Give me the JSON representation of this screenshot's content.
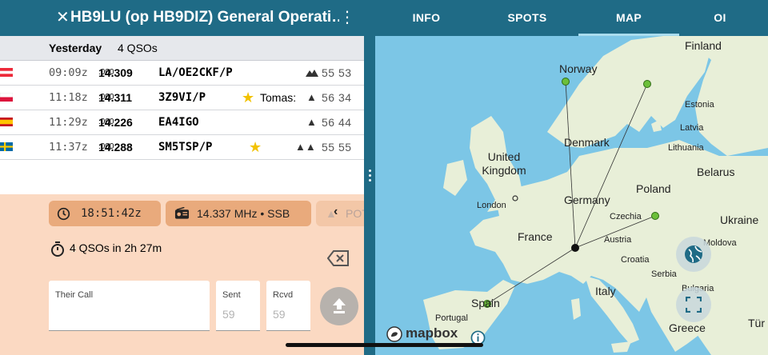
{
  "header": {
    "close_icon": "close-icon",
    "title": "HB9LU (op HB9DIZ) General Operati…",
    "menu_icon": "more-vertical-icon",
    "tabs": [
      {
        "label": "INFO"
      },
      {
        "label": "SPOTS"
      },
      {
        "label": "MAP",
        "active": true
      },
      {
        "label": "OI"
      }
    ]
  },
  "log": {
    "day": "Yesterday",
    "count": "4 QSOs",
    "rows": [
      {
        "time": "09:09z",
        "freq_main": "14.309",
        "freq_small": ".000",
        "call": "LA/OE2CKF/P",
        "flag": "AT",
        "star": "",
        "note": "",
        "icon": "mountain-icon",
        "rst": "55 53"
      },
      {
        "time": "11:18z",
        "freq_main": "14.311",
        "freq_small": ".000",
        "call": "3Z9VI/P",
        "flag": "PL",
        "star": "★",
        "note": "Tomas:",
        "icon": "tree-icon",
        "rst": "56 34"
      },
      {
        "time": "11:29z",
        "freq_main": "14.226",
        "freq_small": ".000",
        "call": "EA4IGO",
        "flag": "ES",
        "star": "",
        "note": "",
        "icon": "tree-icon",
        "rst": "56 44"
      },
      {
        "time": "11:37z",
        "freq_main": "14.288",
        "freq_small": ".000",
        "call": "SM5TSP/P",
        "flag": "SE",
        "star": "★",
        "note": "",
        "icon": "trees-icon",
        "rst": "55 55"
      }
    ]
  },
  "entry": {
    "clock": "18:51:42z",
    "radio": "14.337 MHz • SSB",
    "pota": "POT",
    "summary": "4 QSOs in 2h 27m",
    "their_call_label": "Their Call",
    "sent_label": "Sent",
    "sent_placeholder": "59",
    "rcvd_label": "Rcvd",
    "rcvd_placeholder": "59"
  },
  "map": {
    "countries": [
      "Finland",
      "Norway",
      "Estonia",
      "Latvia",
      "Lithuania",
      "Denmark",
      "United Kingdom",
      "Belarus",
      "Poland",
      "Germany",
      "London",
      "Czechia",
      "Ukraine",
      "France",
      "Austria",
      "Moldova",
      "Croatia",
      "Serbia",
      "Italy",
      "Bulgaria",
      "Spain",
      "Portugal",
      "Greece",
      "Tür"
    ],
    "attribution": "mapbox",
    "colors": {
      "sea": "#7cc6e6",
      "land": "#e8efd8",
      "spot": "#6cbf3a",
      "home": "#111111"
    }
  },
  "colors": {
    "header": "#1f6b86",
    "entry_bg": "#fbd9c2",
    "chip": "#e9aa7c"
  }
}
